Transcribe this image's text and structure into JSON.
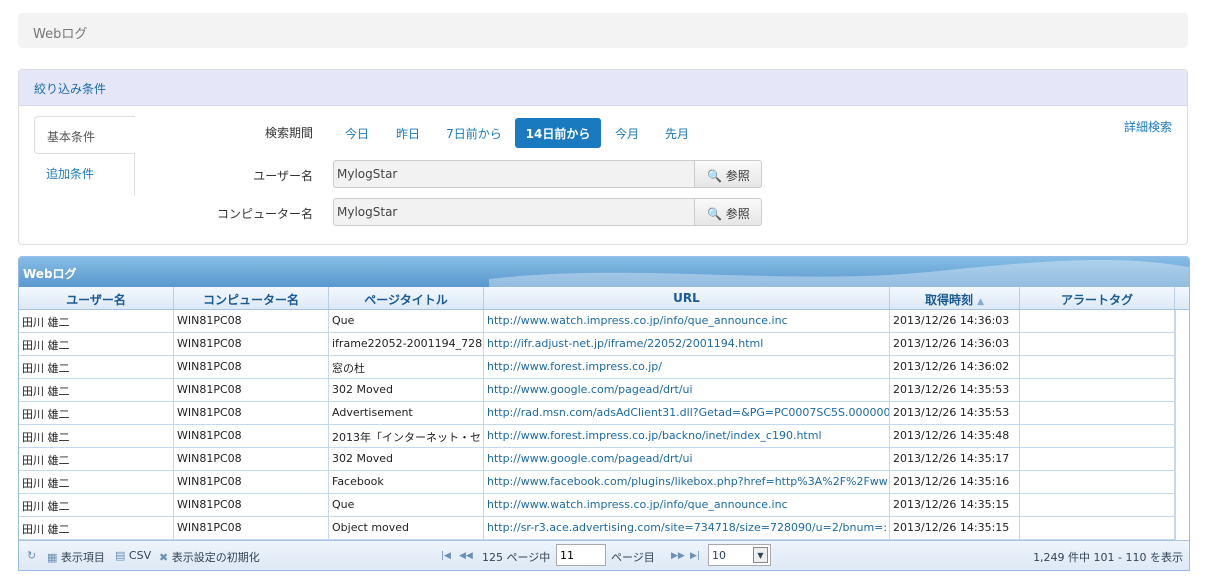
{
  "breadcrumb": {
    "title": "Webログ"
  },
  "filter": {
    "header": "絞り込み条件",
    "tabs": [
      {
        "label": "基本条件"
      },
      {
        "label": "追加条件"
      }
    ],
    "period_label": "検索期間",
    "periods": [
      {
        "label": "今日"
      },
      {
        "label": "昨日"
      },
      {
        "label": "7日前から"
      },
      {
        "label": "14日前から",
        "active": true
      },
      {
        "label": "今月"
      },
      {
        "label": "先月"
      }
    ],
    "user_label": "ユーザー名",
    "user_value": "MylogStar",
    "computer_label": "コンピューター名",
    "computer_value": "MylogStar",
    "ref_button": "参照",
    "detail_search": "詳細検索"
  },
  "grid": {
    "title": "Webログ",
    "columns": [
      "ユーザー名",
      "コンピューター名",
      "ページタイトル",
      "URL",
      "取得時刻",
      "アラートタグ"
    ],
    "rows": [
      [
        "田川 雄二",
        "WIN81PC08",
        "Que",
        "http://www.watch.impress.co.jp/info/que_announce.inc",
        "2013/12/26 14:36:03",
        ""
      ],
      [
        "田川 雄二",
        "WIN81PC08",
        "iframe22052-2001194_728",
        "http://ifr.adjust-net.jp/iframe/22052/2001194.html",
        "2013/12/26 14:36:03",
        ""
      ],
      [
        "田川 雄二",
        "WIN81PC08",
        "窓の杜",
        "http://www.forest.impress.co.jp/",
        "2013/12/26 14:36:02",
        ""
      ],
      [
        "田川 雄二",
        "WIN81PC08",
        "302 Moved",
        "http://www.google.com/pagead/drt/ui",
        "2013/12/26 14:35:53",
        ""
      ],
      [
        "田川 雄二",
        "WIN81PC08",
        "Advertisement",
        "http://rad.msn.com/adsAdClient31.dll?Getad=&PG=PC0007SC5S.000000",
        "2013/12/26 14:35:53",
        ""
      ],
      [
        "田川 雄二",
        "WIN81PC08",
        "2013年「インターネット・セ",
        "http://www.forest.impress.co.jp/backno/inet/index_c190.html",
        "2013/12/26 14:35:48",
        ""
      ],
      [
        "田川 雄二",
        "WIN81PC08",
        "302 Moved",
        "http://www.google.com/pagead/drt/ui",
        "2013/12/26 14:35:17",
        ""
      ],
      [
        "田川 雄二",
        "WIN81PC08",
        "Facebook",
        "http://www.facebook.com/plugins/likebox.php?href=http%3A%2F%2Fww",
        "2013/12/26 14:35:16",
        ""
      ],
      [
        "田川 雄二",
        "WIN81PC08",
        "Que",
        "http://www.watch.impress.co.jp/info/que_announce.inc",
        "2013/12/26 14:35:15",
        ""
      ],
      [
        "田川 雄二",
        "WIN81PC08",
        "Object moved",
        "http://sr-r3.ace.advertising.com/site=734718/size=728090/u=2/bnum=:",
        "2013/12/26 14:35:15",
        ""
      ]
    ]
  },
  "pager": {
    "display_items": "表示項目",
    "csv": "CSV",
    "reset": "表示設定の初期化",
    "pages_prefix": "125 ページ中",
    "current_page": "11",
    "pages_suffix": "ページ目",
    "page_size": "10",
    "summary": "1,249 件中 101 - 110 を表示"
  },
  "colors": {
    "accent": "#1a7ac0",
    "grid_header": "#5a98cf",
    "filter_header": "#e5e7f8"
  }
}
